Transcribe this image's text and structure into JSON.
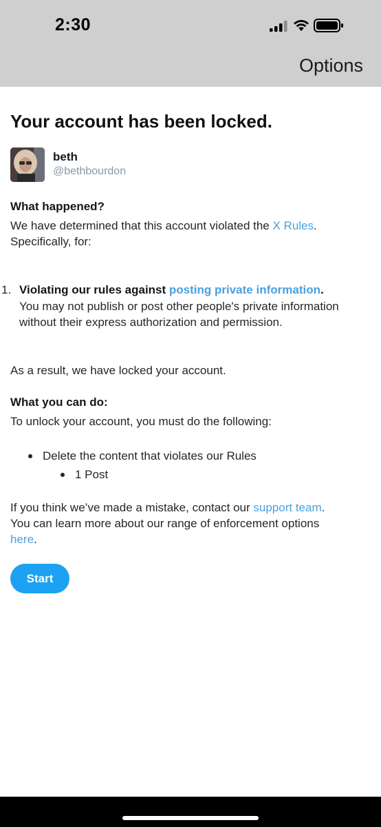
{
  "status_bar": {
    "time": "2:30",
    "icons": [
      "signal-icon",
      "wifi-icon",
      "battery-icon"
    ]
  },
  "header": {
    "options_label": "Options"
  },
  "page": {
    "title": "Your account has been locked.",
    "user": {
      "display_name": "beth",
      "handle": "@bethbourdon"
    },
    "what_happened": {
      "heading": "What happened?",
      "line1_prefix": "We have determined that this account violated the ",
      "rules_link": "X Rules",
      "line1_suffix": ".",
      "line2": "Specifically, for:"
    },
    "violation": {
      "number": "1.",
      "title_prefix": "Violating our rules against ",
      "title_link": "posting private information",
      "title_suffix": ".",
      "desc_line1": "You may not publish or post other people's private information",
      "desc_line2": "without their express authorization and permission."
    },
    "result_text": "As a result, we have locked your account.",
    "what_you_can_do": {
      "heading": "What you can do:",
      "instruction": "To unlock your account, you must do the following:",
      "steps": [
        "Delete the content that violates our Rules"
      ],
      "substeps": [
        "1 Post"
      ]
    },
    "mistake": {
      "line1_prefix": "If you think we’ve made a mistake, contact our ",
      "support_link": "support team",
      "line1_suffix": ".",
      "line2": "You can learn more about our range of enforcement options",
      "here_link": "here",
      "line3_suffix": "."
    },
    "start_button": "Start"
  },
  "colors": {
    "accent": "#1da1f2",
    "link": "#4aa0de",
    "header_bg": "#cfcfcf"
  }
}
